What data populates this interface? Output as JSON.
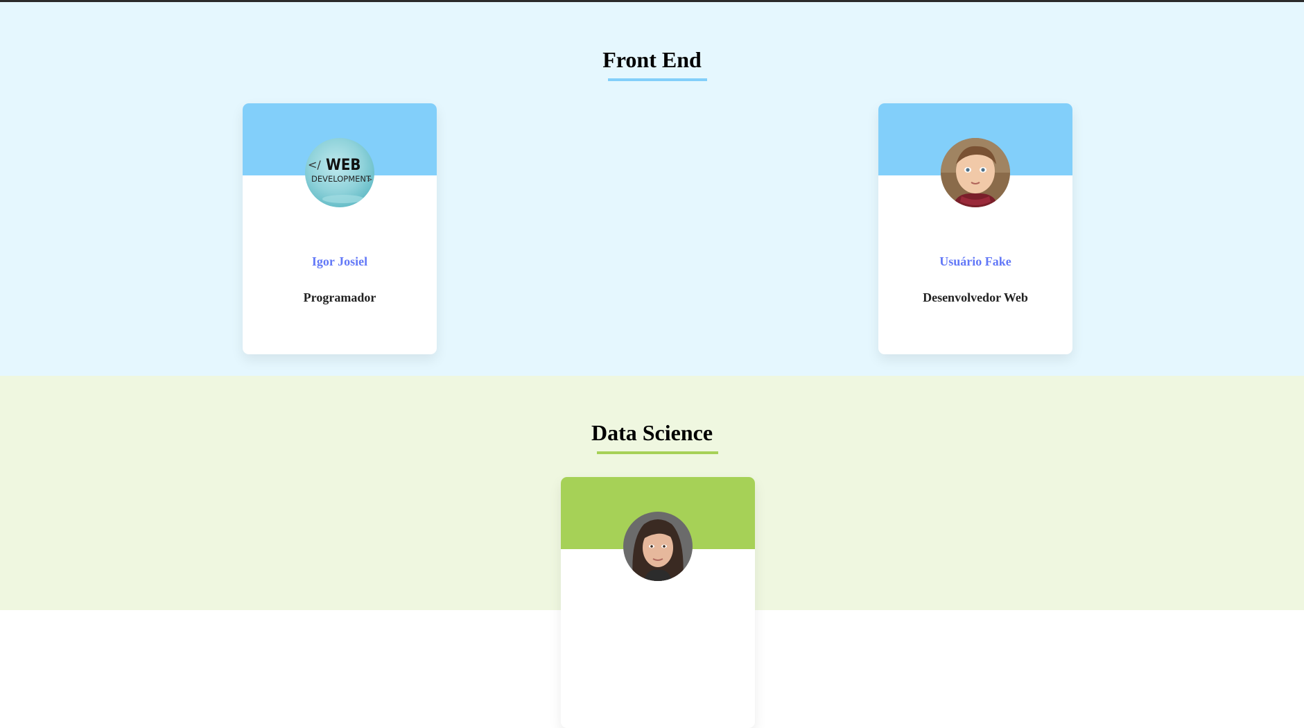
{
  "sections": [
    {
      "title": "Front End",
      "primary_color": "#82cffa",
      "background_color": "#e5f7fe",
      "members": [
        {
          "name": "Igor Josiel",
          "role": "Programador",
          "avatar": "web-development-badge",
          "avatar_text_line1": "WEB",
          "avatar_text_line2": "DEVELOPMENT"
        },
        {
          "name": "Usuário Fake",
          "role": "Desenvolvedor Web",
          "avatar": "child-portrait-photo"
        }
      ]
    },
    {
      "title": "Data Science",
      "primary_color": "#a6d157",
      "background_color": "#eff7e0",
      "members": [
        {
          "avatar": "woman-portrait-photo"
        }
      ]
    }
  ],
  "colors": {
    "name_text": "#6278f7",
    "role_text": "#212121"
  }
}
